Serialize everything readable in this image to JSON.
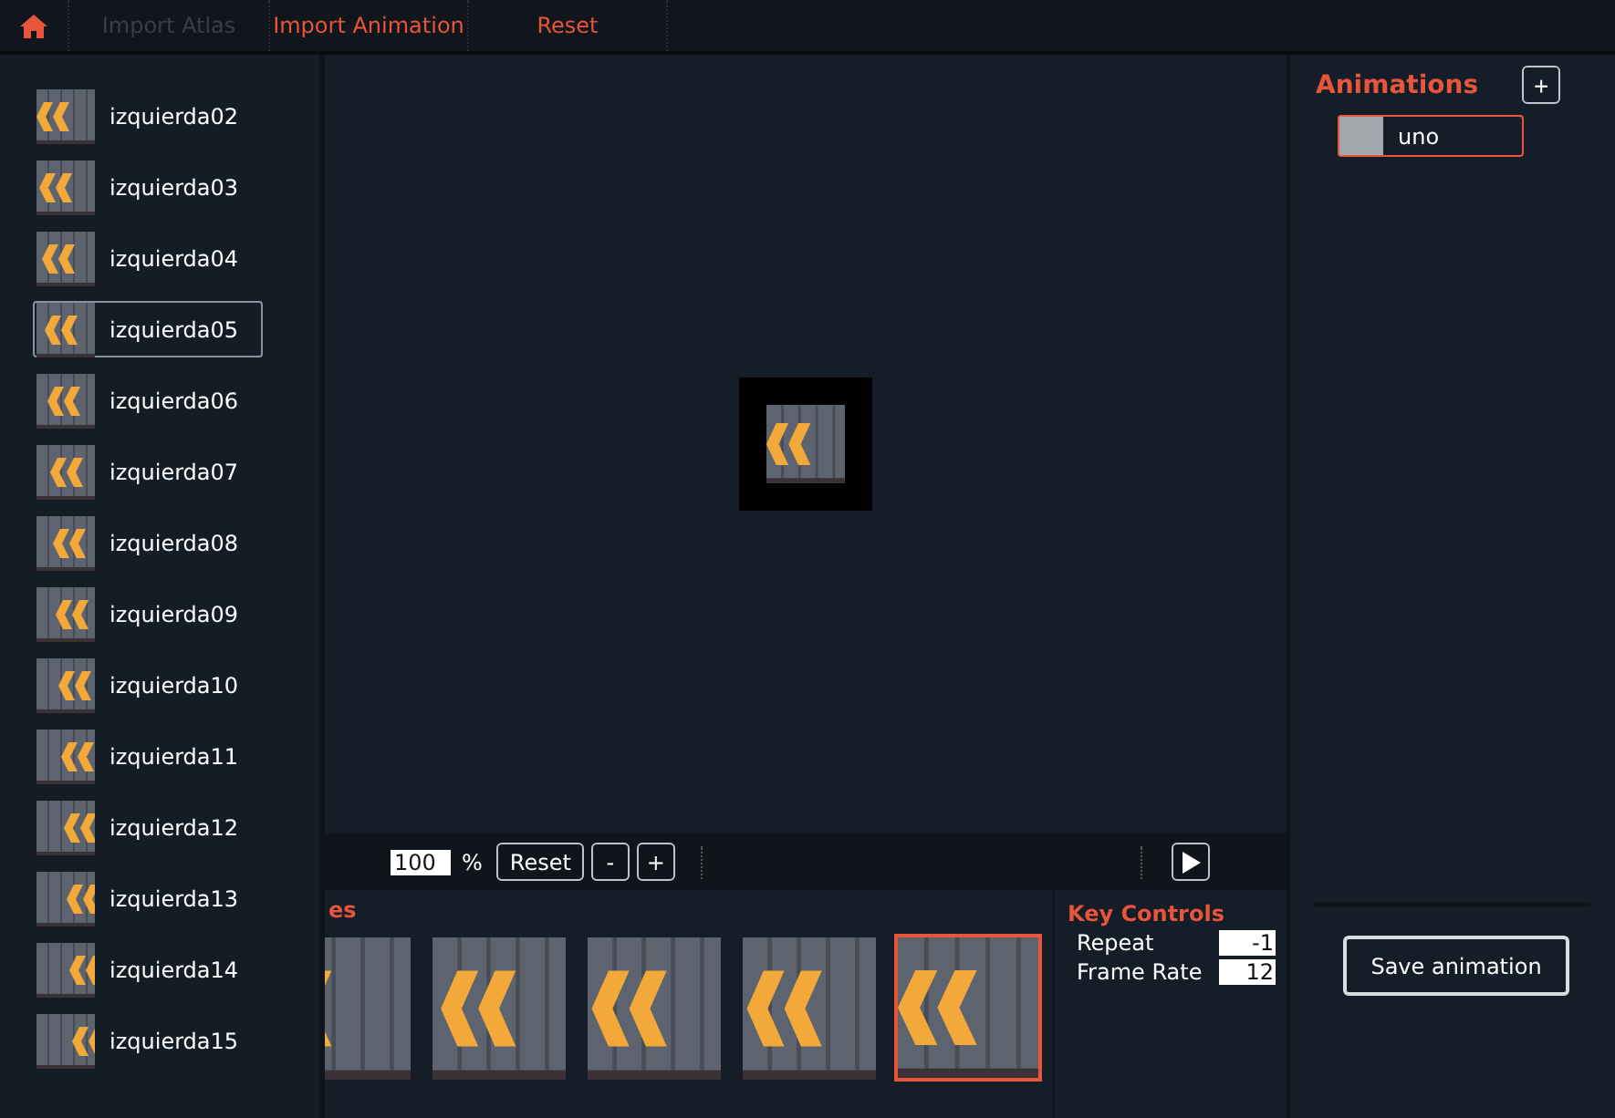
{
  "toolbar": {
    "buttons": [
      {
        "kind": "home"
      },
      {
        "kind": "text",
        "label": "Import Atlas",
        "disabled": true
      },
      {
        "kind": "text",
        "label": "Import Animation",
        "disabled": false
      },
      {
        "kind": "text",
        "label": "Reset",
        "disabled": false
      }
    ]
  },
  "sidebar": {
    "items": [
      {
        "label": "izquierda02",
        "selected": false
      },
      {
        "label": "izquierda03",
        "selected": false
      },
      {
        "label": "izquierda04",
        "selected": false
      },
      {
        "label": "izquierda05",
        "selected": true
      },
      {
        "label": "izquierda06",
        "selected": false
      },
      {
        "label": "izquierda07",
        "selected": false
      },
      {
        "label": "izquierda08",
        "selected": false
      },
      {
        "label": "izquierda09",
        "selected": false
      },
      {
        "label": "izquierda10",
        "selected": false
      },
      {
        "label": "izquierda11",
        "selected": false
      },
      {
        "label": "izquierda12",
        "selected": false
      },
      {
        "label": "izquierda13",
        "selected": false
      },
      {
        "label": "izquierda14",
        "selected": false
      },
      {
        "label": "izquierda15",
        "selected": false
      }
    ]
  },
  "viewer": {
    "zoom": "100",
    "unit": "%",
    "buttons": [
      "Reset",
      "-",
      "+"
    ]
  },
  "frames_panel": {
    "title": "es",
    "frames": [
      {
        "selected": false
      },
      {
        "selected": false
      },
      {
        "selected": false
      },
      {
        "selected": false
      },
      {
        "selected": true
      }
    ]
  },
  "key_controls": {
    "title": "Key Controls",
    "fields": [
      {
        "label": "Repeat",
        "value": "-1"
      },
      {
        "label": "Frame Rate",
        "value": "12"
      }
    ]
  },
  "animations": {
    "title": "Animations",
    "add_button": "+",
    "items": [
      {
        "label": "uno",
        "selected": true
      }
    ]
  },
  "save_button": "Save animation"
}
